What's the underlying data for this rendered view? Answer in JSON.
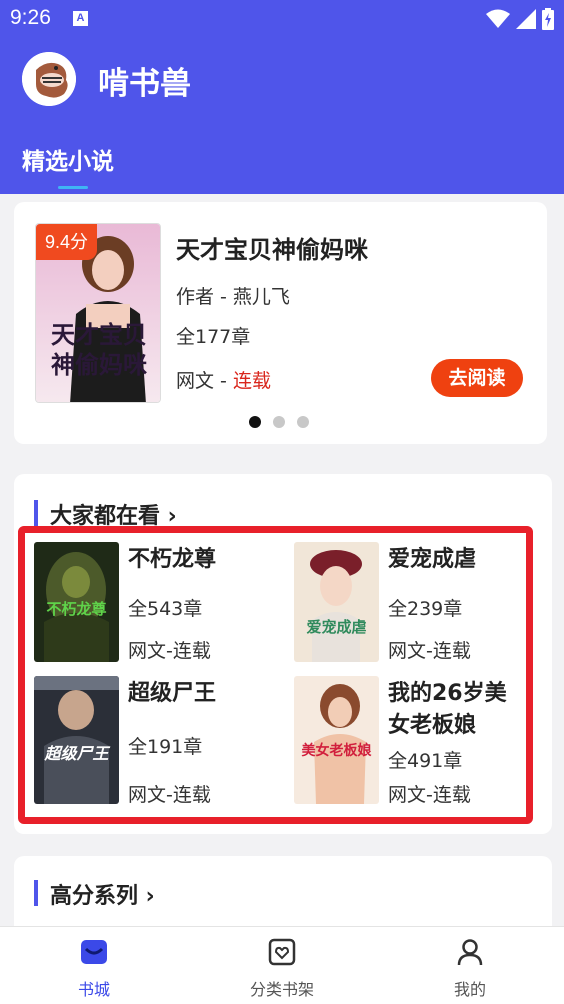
{
  "status_bar": {
    "time": "9:26",
    "notification_letter": "A"
  },
  "app": {
    "title": "啃书兽"
  },
  "tabs": [
    {
      "label": "精选小说",
      "active": true
    }
  ],
  "featured": {
    "score": "9.4分",
    "title": "天才宝贝神偷妈咪",
    "author": "作者 - 燕儿飞",
    "chapters": "全177章",
    "source": "网文 - ",
    "status": "连载",
    "read_button": "去阅读",
    "cover_text": "天才宝贝神偷妈咪",
    "carousel_pages": 3,
    "carousel_active": 0
  },
  "popular": {
    "title": "大家都在看 ›",
    "books": [
      {
        "title": "不朽龙尊",
        "chapters": "全543章",
        "status": "网文-连载",
        "cover_text": "不朽龙尊"
      },
      {
        "title": "爱宠成虐",
        "chapters": "全239章",
        "status": "网文-连载",
        "cover_text": "爱宠成虐"
      },
      {
        "title": "超级尸王",
        "chapters": "全191章",
        "status": "网文-连载",
        "cover_text": "超级尸王"
      },
      {
        "title_line1": "我的26岁美",
        "title_line2": "女老板娘",
        "chapters": "全491章",
        "status": "网文-连载",
        "cover_text": "美女老板娘"
      }
    ]
  },
  "highscore": {
    "title": "高分系列 ›"
  },
  "bottom_nav": [
    {
      "label": "书城",
      "icon": "bookstore-icon",
      "active": true
    },
    {
      "label": "分类书架",
      "icon": "shelf-icon",
      "active": false
    },
    {
      "label": "我的",
      "icon": "profile-icon",
      "active": false
    }
  ],
  "colors": {
    "brand": "#4f55ea",
    "accent": "#ef4110",
    "highlight": "#e8202a"
  }
}
